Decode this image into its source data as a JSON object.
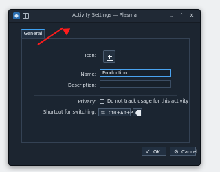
{
  "window": {
    "title": "Activity Settings — Plasma"
  },
  "tabs": [
    {
      "label": "General"
    }
  ],
  "form": {
    "icon_label": "Icon:",
    "name_label": "Name:",
    "name_value": "Production",
    "description_label": "Description:",
    "description_value": "",
    "privacy_label": "Privacy:",
    "privacy_checkbox_label": "Do not track usage for this activity",
    "shortcut_label": "Shortcut for switching:",
    "shortcut_value": "Ctrl+Alt+P"
  },
  "buttons": {
    "ok": "OK",
    "cancel": "Cancel"
  },
  "icons": {
    "app": "plasma-app-icon",
    "pin": "window-pin-icon",
    "minimize": "chevron-down-icon",
    "maximize": "chevron-up-icon",
    "close": "close-icon",
    "activity": "activity-icon",
    "shortcut": "keyboard-shortcut-icon",
    "clear": "clear-shortcut-icon",
    "ok": "checkmark-icon",
    "cancel": "cancel-icon",
    "annotation": "red-arrow-annotation"
  }
}
